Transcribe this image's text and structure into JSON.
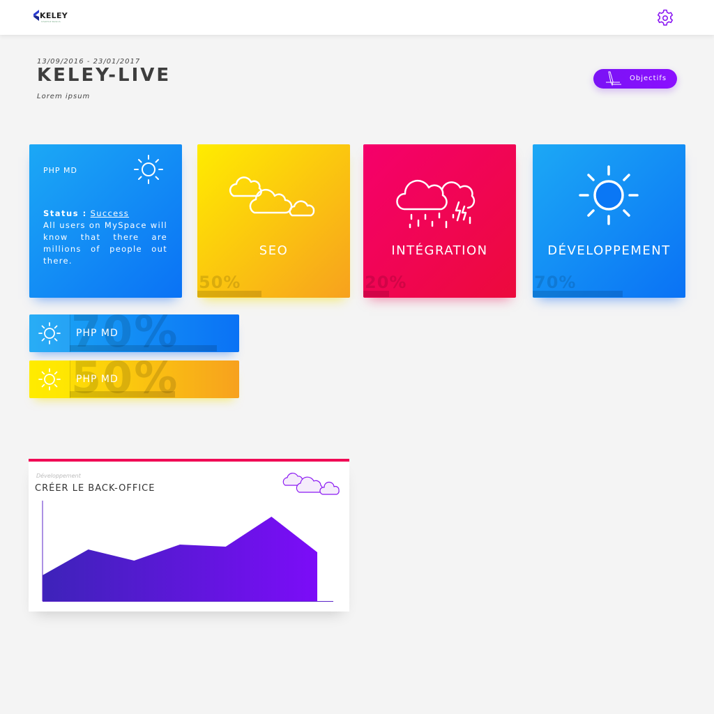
{
  "header": {
    "logo_text": "KELEY",
    "logo_subtext": "STARTUP BASICS",
    "settings_icon": "gear-icon",
    "accent_color": "#7a12f5"
  },
  "project": {
    "dates": "13/09/2016 - 23/01/2017",
    "title": "KELEY-LIVE",
    "subtitle": "Lorem ipsum",
    "objectives_button": "Objectifs"
  },
  "cards": [
    {
      "title": "PHP MD",
      "icon": "sun-icon",
      "status_label": "Status :",
      "status_value": "Success",
      "description": "All users on MySpace will know that there are millions of people out there."
    },
    {
      "label": "SEO",
      "icon": "cloudy-icon",
      "percent": "50%",
      "progress": 0.42,
      "color": "#ffd800"
    },
    {
      "label": "INTÉGRATION",
      "icon": "storm-icon",
      "percent": "20%",
      "progress": 0.17,
      "color": "#f00a55"
    },
    {
      "label": "DÉVELOPPEMENT",
      "icon": "sun-icon",
      "percent": "70%",
      "progress": 0.59,
      "color": "#0a8bf5"
    }
  ],
  "bars": [
    {
      "label": "PHP MD",
      "percent": "70%",
      "progress": 0.7,
      "icon": "sun-icon"
    },
    {
      "label": "PHP MD",
      "percent": "50%",
      "progress": 0.5,
      "icon": "sun-icon"
    }
  ],
  "chart_card": {
    "category": "Développement",
    "title": "CRÉER LE BACK-OFFICE",
    "icon": "cloudy-icon"
  },
  "chart_data": {
    "type": "area",
    "x": [
      0,
      1,
      2,
      3,
      4,
      5,
      6
    ],
    "values": [
      37,
      74,
      58,
      81,
      78,
      121,
      70
    ],
    "ylim": [
      0,
      145
    ],
    "xlim": [
      0,
      6.35
    ],
    "grid": false,
    "legend": "none",
    "colors": [
      "#3d23b9",
      "#7c0cf8"
    ]
  }
}
